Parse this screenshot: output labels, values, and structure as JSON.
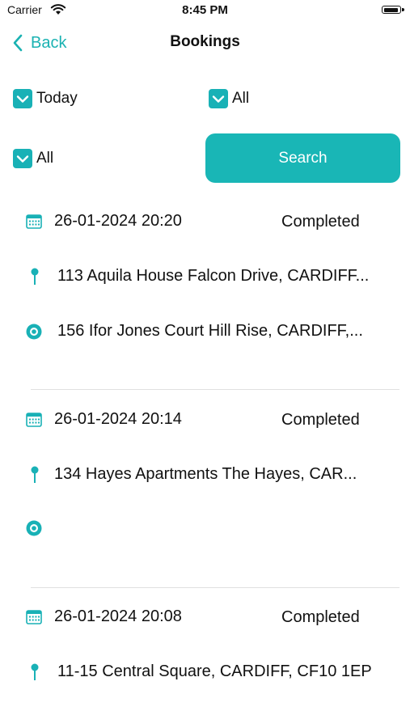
{
  "status_bar": {
    "carrier": "Carrier",
    "time": "8:45 PM"
  },
  "nav": {
    "back_label": "Back",
    "title": "Bookings"
  },
  "filters": {
    "date_filter": {
      "label": "Today",
      "checked": true
    },
    "type_filter": {
      "label": "All",
      "checked": true
    },
    "status_filter": {
      "label": "All",
      "checked": true
    },
    "search_label": "Search"
  },
  "colors": {
    "accent": "#19b1b6",
    "text": "#111111",
    "divider": "#e0e0e0"
  },
  "bookings": [
    {
      "datetime": "26-01-2024 20:20",
      "status": "Completed",
      "pickup": "113 Aquila House Falcon Drive, CARDIFF...",
      "dropoff": "156 Ifor Jones Court Hill Rise, CARDIFF,..."
    },
    {
      "datetime": "26-01-2024 20:14",
      "status": "Completed",
      "pickup": "134 Hayes Apartments The Hayes, CAR...",
      "dropoff": ""
    },
    {
      "datetime": "26-01-2024 20:08",
      "status": "Completed",
      "pickup": "11-15 Central Square, CARDIFF, CF10 1EP"
    }
  ]
}
